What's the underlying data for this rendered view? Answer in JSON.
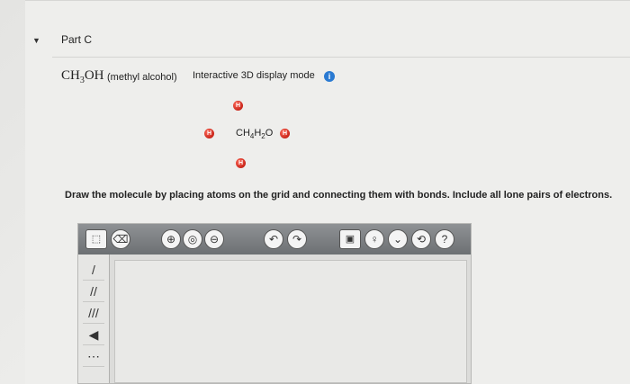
{
  "part": {
    "toggle_icon": "triangle-down-icon",
    "title": "Part C"
  },
  "molecule": {
    "formula_main": "CH",
    "formula_sub": "3",
    "formula_tail": "OH",
    "name": "(methyl alcohol)",
    "mode_label": "Interactive 3D display mode",
    "info_icon": "i"
  },
  "structure": {
    "atom_label": "H",
    "formula_parts": [
      "CH",
      "4",
      "H",
      "2",
      "O"
    ],
    "atom_color": "#d32f22"
  },
  "instructions": "Draw the molecule by placing atoms on the grid and connecting them with bonds. Include all lone pairs of electrons.",
  "editor": {
    "toolbar": {
      "select_icon": "select-tool-icon",
      "eraser_icon": "eraser-icon",
      "zoom_in": "⊕",
      "zoom_fit": "◎",
      "zoom_out": "⊖",
      "undo": "↶",
      "redo": "↷",
      "template": "▣",
      "info": "♀",
      "more": "⌄",
      "reset": "⟲",
      "help": "?"
    },
    "side_tools": [
      "/",
      "//",
      "///",
      "◀",
      "⋯"
    ]
  }
}
